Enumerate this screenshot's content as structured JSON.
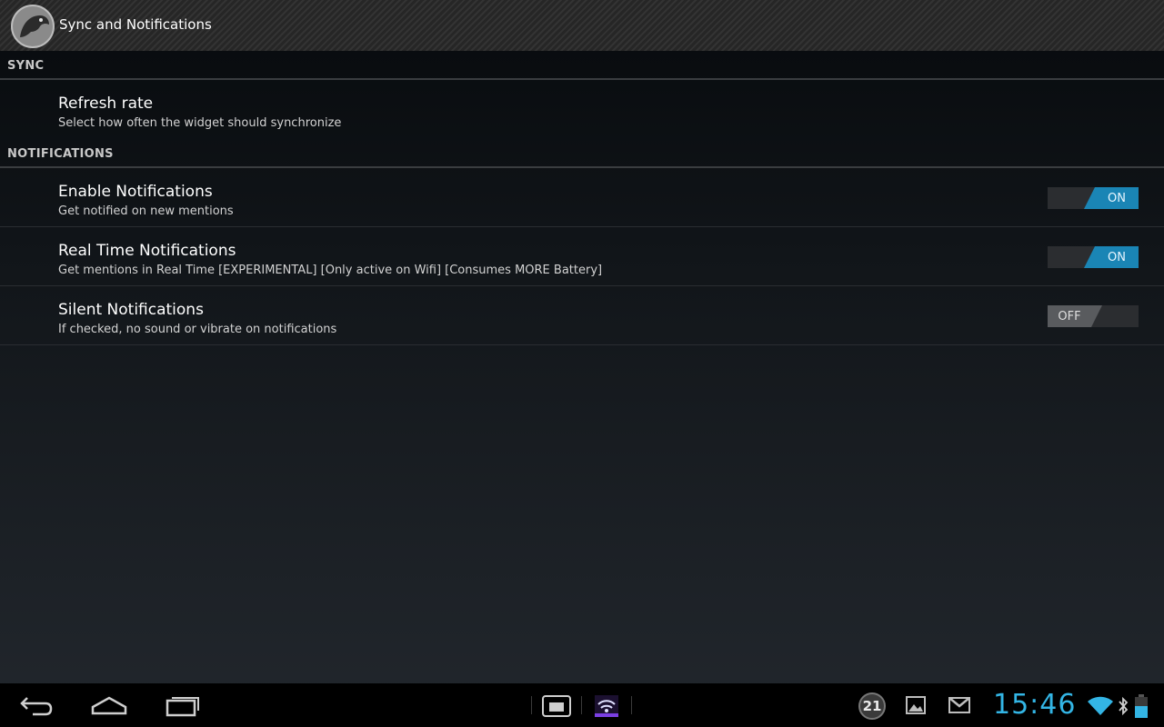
{
  "action_bar": {
    "title": "Sync and Notifications",
    "app_icon": "parrot-logo-icon"
  },
  "sections": [
    {
      "header": "SYNC",
      "items": [
        {
          "title": "Refresh rate",
          "summary": "Select how often the widget should synchronize"
        }
      ]
    },
    {
      "header": "NOTIFICATIONS",
      "items": [
        {
          "title": "Enable Notifications",
          "summary": "Get notified on new mentions",
          "toggle": "ON"
        },
        {
          "title": "Real Time Notifications",
          "summary": "Get mentions in Real Time [EXPERIMENTAL] [Only active on Wifi] [Consumes MORE Battery]",
          "toggle": "ON"
        },
        {
          "title": "Silent Notifications",
          "summary": "If checked, no sound or vibrate on notifications",
          "toggle": "OFF"
        }
      ]
    }
  ],
  "system_bar": {
    "clock": "15:46",
    "notification_count": "21",
    "icons": [
      "back-icon",
      "home-icon",
      "recent-apps-icon",
      "screenshot-icon",
      "wifi-hotspot-icon",
      "gallery-icon",
      "gmail-icon",
      "wifi-signal-icon",
      "bluetooth-icon",
      "battery-icon"
    ]
  },
  "colors": {
    "accent": "#33b5e5",
    "toggle_on": "#1a85b5",
    "toggle_off": "#595b5e"
  }
}
